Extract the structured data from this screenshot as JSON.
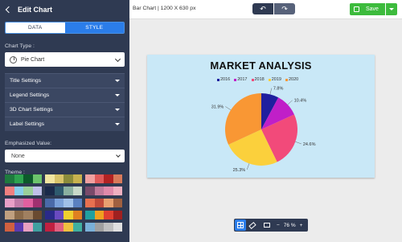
{
  "sidebar": {
    "header": "Edit Chart",
    "tabs": {
      "data": "DATA",
      "style": "STYLE"
    },
    "chart_type_label": "Chart Type :",
    "chart_type_value": "Pie Chart",
    "sections": [
      "Title Settings",
      "Legend Settings",
      "3D Chart Settings",
      "Label Settings"
    ],
    "emphasized_label": "Emphasized Value:",
    "emphasized_value": "None",
    "theme_label": "Theme :",
    "palettes": [
      [
        "#1e7a3e",
        "#2ea34f",
        "#0c5a2a",
        "#6cc46c"
      ],
      [
        "#f2e6a0",
        "#d8c46a",
        "#8c8c3a",
        "#c8b24e"
      ],
      [
        "#f0a0a0",
        "#e05a5a",
        "#b22222",
        "#d87a5a"
      ],
      [
        "#f08080",
        "#87ceeb",
        "#9ad09a",
        "#c0c0e8"
      ],
      [
        "#1a2a4a",
        "#2e5a6e",
        "#8ab0a0",
        "#c8d8c8"
      ],
      [
        "#7a4a6a",
        "#c07a9a",
        "#e08aaa",
        "#f0b0c0"
      ],
      [
        "#e8a0c8",
        "#c07aa8",
        "#e060a0",
        "#a03070"
      ],
      [
        "#4a6aa8",
        "#7aa0d8",
        "#a0c0e8",
        "#5a80c0"
      ],
      [
        "#e87050",
        "#c04a3a",
        "#e8a070",
        "#a06040"
      ],
      [
        "#c0a080",
        "#8a6a4a",
        "#a08060",
        "#6a4a30"
      ],
      [
        "#2a2a8a",
        "#6a4ac0",
        "#f0d030",
        "#e08020"
      ],
      [
        "#20a0a0",
        "#f0a020",
        "#e04030",
        "#a02020"
      ],
      [
        "#d06040",
        "#5a3ab0",
        "#e8a0c0",
        "#40a0a0"
      ],
      [
        "#c02040",
        "#e06080",
        "#f0c040",
        "#40b0a0"
      ],
      [
        "#7ab0d8",
        "#a0a0a0",
        "#c0c0c0",
        "#e0e0e0"
      ]
    ]
  },
  "topbar": {
    "doc_title": "Bar Chart | 1200 X 630 px",
    "save_label": "Save"
  },
  "canvas": {
    "background": "#c9e8f7"
  },
  "chart_data": {
    "type": "pie",
    "title": "MARKET ANALYSIS",
    "legend_position": "top",
    "categories": [
      "2016",
      "2017",
      "2018",
      "2019",
      "2020"
    ],
    "values": [
      7.8,
      10.4,
      24.6,
      25.3,
      31.9
    ],
    "labels": [
      "7.8%",
      "10.4%",
      "24.6%",
      "25.3%",
      "31.9%"
    ],
    "colors": [
      "#1f1f9e",
      "#c01fc8",
      "#f24a7a",
      "#fbd03c",
      "#f99734"
    ]
  },
  "bottom_bar": {
    "zoom": "76 %",
    "minus": "−",
    "plus": "+"
  }
}
